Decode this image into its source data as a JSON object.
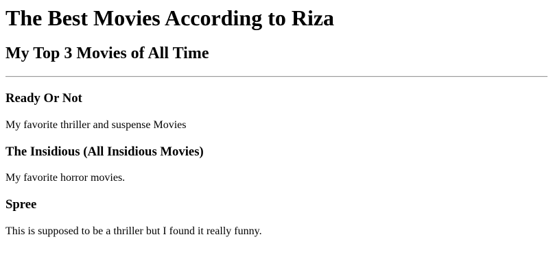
{
  "page": {
    "title": "The Best Movies According to Riza",
    "subtitle": "My Top 3 Movies of All Time"
  },
  "movies": [
    {
      "title": "Ready Or Not",
      "description": "My favorite thriller and suspense Movies"
    },
    {
      "title": "The Insidious (All Insidious Movies)",
      "description": "My favorite horror movies."
    },
    {
      "title": "Spree",
      "description": "This is supposed to be a thriller but I found it really funny."
    }
  ]
}
